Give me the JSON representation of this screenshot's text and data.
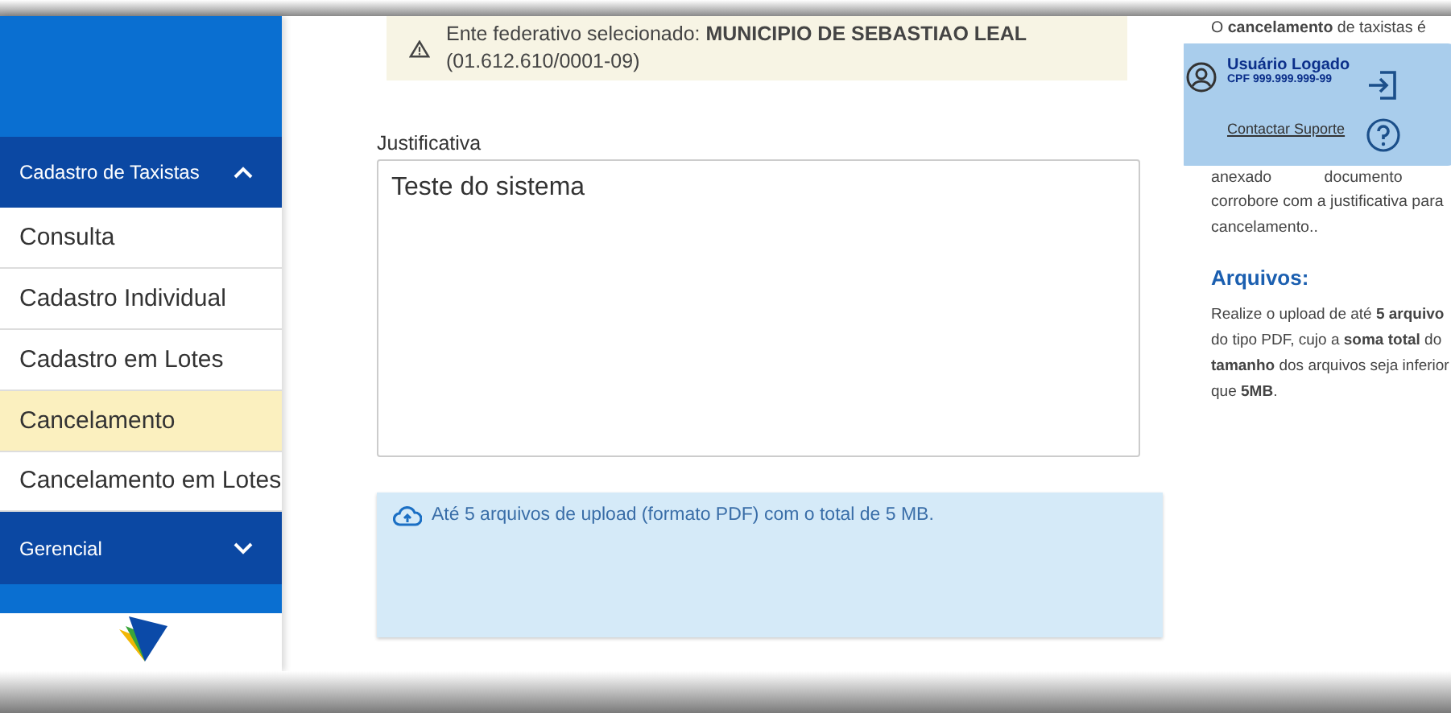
{
  "sidebar": {
    "sections": [
      {
        "label": "Cadastro de Taxistas",
        "expanded": true,
        "items": [
          {
            "label": "Consulta",
            "selected": false
          },
          {
            "label": "Cadastro Individual",
            "selected": false
          },
          {
            "label": "Cadastro em Lotes",
            "selected": false
          },
          {
            "label": "Cancelamento",
            "selected": true
          },
          {
            "label": "Cancelamento em Lotes",
            "selected": false
          }
        ]
      },
      {
        "label": "Gerencial",
        "expanded": false
      }
    ]
  },
  "alert": {
    "text": "Ente federativo selecionado: **MUNICIPIO DE SEBASTIAO LEAL** (01.612.610/0001-09)"
  },
  "justificativa": {
    "label": "Justificativa",
    "value": "Teste do sistema"
  },
  "upload": {
    "text": "Até 5 arquivos de upload (formato PDF) com o total de 5 MB."
  },
  "help": {
    "lines_top": [
      "O **cancelamento** de taxistas é"
    ],
    "lines_bottom": [
      "anexado documento",
      "corrobore com a justificativa para",
      "cancelamento.."
    ],
    "files_title": "Arquivos:",
    "files_text": "Realize o upload de até **5 arquivo** do tipo PDF, cujo a **soma total** do **tamanho** dos arquivos seja inferior que **5MB**."
  },
  "user_popup": {
    "name": "Usuário Logado",
    "cpf": "CPF 999.999.999-99",
    "support": "Contactar Suporte"
  }
}
